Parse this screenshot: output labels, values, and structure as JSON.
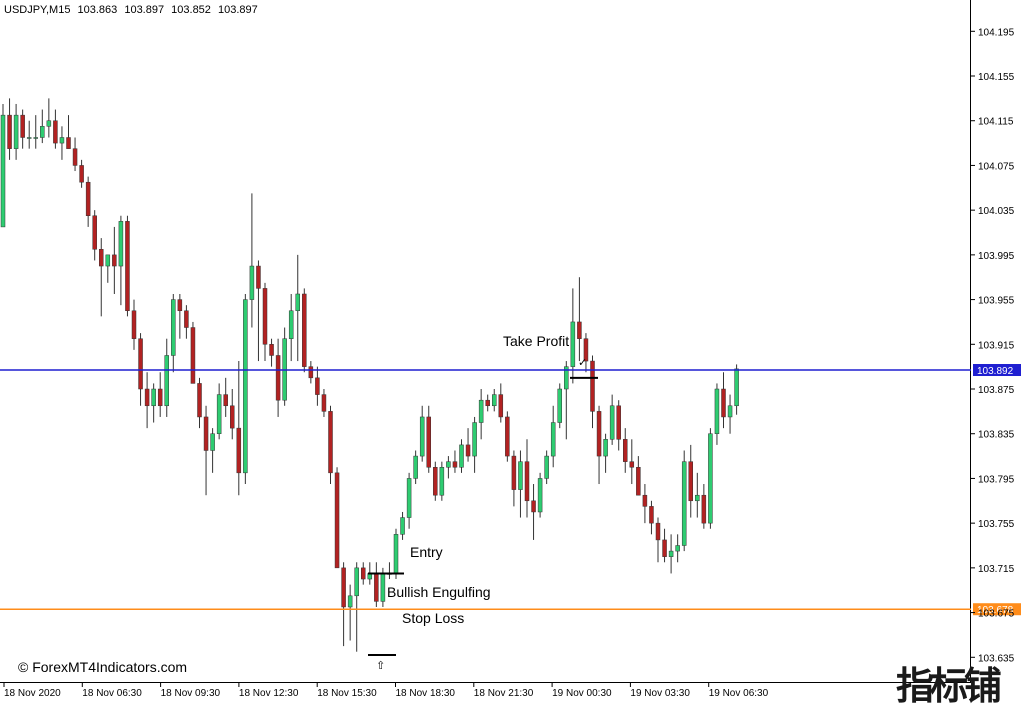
{
  "chart_header": {
    "symbol": "USDJPY,M15",
    "open": "103.863",
    "high": "103.897",
    "low": "103.852",
    "close": "103.897"
  },
  "annotations": {
    "take_profit": "Take Profit",
    "entry": "Entry",
    "pattern": "Bullish Engulfing",
    "stop_loss": "Stop Loss"
  },
  "copyright": "© ForexMT4Indicators.com",
  "watermark": "指标铺",
  "colors": {
    "bull": "#2ecc71",
    "bear": "#b22222",
    "take_profit_line": "#1f1fd1",
    "stop_line": "#ff8c1a",
    "background": "#ffffff"
  },
  "chart_data": {
    "type": "candlestick",
    "y_ticks": [
      "104.195",
      "104.155",
      "104.115",
      "104.075",
      "104.035",
      "103.995",
      "103.955",
      "103.915",
      "103.875",
      "103.835",
      "103.795",
      "103.755",
      "103.715",
      "103.675",
      "103.635"
    ],
    "ylim": [
      103.612,
      104.223
    ],
    "x_ticks": [
      "18 Nov 2020",
      "18 Nov 06:30",
      "18 Nov 09:30",
      "18 Nov 12:30",
      "18 Nov 15:30",
      "18 Nov 18:30",
      "18 Nov 21:30",
      "19 Nov 00:30",
      "19 Nov 03:30",
      "19 Nov 06:30"
    ],
    "price_lines": [
      {
        "label": "103.892",
        "value": 103.892,
        "color": "#1f1fd1"
      },
      {
        "label": "103.678",
        "value": 103.678,
        "color": "#ff8c1a"
      }
    ],
    "candles": [
      {
        "o": 104.02,
        "h": 104.13,
        "l": 104.06,
        "c": 104.12
      },
      {
        "o": 104.12,
        "h": 104.135,
        "l": 104.08,
        "c": 104.09
      },
      {
        "o": 104.09,
        "h": 104.13,
        "l": 104.08,
        "c": 104.12
      },
      {
        "o": 104.12,
        "h": 104.125,
        "l": 104.09,
        "c": 104.1
      },
      {
        "o": 104.1,
        "h": 104.115,
        "l": 104.09,
        "c": 104.1
      },
      {
        "o": 104.1,
        "h": 104.12,
        "l": 104.09,
        "c": 104.1
      },
      {
        "o": 104.1,
        "h": 104.125,
        "l": 104.095,
        "c": 104.11
      },
      {
        "o": 104.11,
        "h": 104.135,
        "l": 104.1,
        "c": 104.115
      },
      {
        "o": 104.115,
        "h": 104.125,
        "l": 104.09,
        "c": 104.095
      },
      {
        "o": 104.095,
        "h": 104.11,
        "l": 104.08,
        "c": 104.1
      },
      {
        "o": 104.1,
        "h": 104.12,
        "l": 104.09,
        "c": 104.09
      },
      {
        "o": 104.09,
        "h": 104.1,
        "l": 104.07,
        "c": 104.075
      },
      {
        "o": 104.075,
        "h": 104.08,
        "l": 104.055,
        "c": 104.06
      },
      {
        "o": 104.06,
        "h": 104.065,
        "l": 104.02,
        "c": 104.03
      },
      {
        "o": 104.03,
        "h": 104.035,
        "l": 103.99,
        "c": 104.0
      },
      {
        "o": 104.0,
        "h": 104.01,
        "l": 103.94,
        "c": 103.985
      },
      {
        "o": 103.985,
        "h": 103.995,
        "l": 103.97,
        "c": 103.995
      },
      {
        "o": 103.995,
        "h": 104.02,
        "l": 103.96,
        "c": 103.985
      },
      {
        "o": 103.985,
        "h": 104.03,
        "l": 103.95,
        "c": 104.025
      },
      {
        "o": 104.025,
        "h": 104.03,
        "l": 103.94,
        "c": 103.945
      },
      {
        "o": 103.945,
        "h": 103.955,
        "l": 103.91,
        "c": 103.92
      },
      {
        "o": 103.92,
        "h": 103.925,
        "l": 103.86,
        "c": 103.875
      },
      {
        "o": 103.875,
        "h": 103.89,
        "l": 103.84,
        "c": 103.86
      },
      {
        "o": 103.86,
        "h": 103.88,
        "l": 103.845,
        "c": 103.875
      },
      {
        "o": 103.875,
        "h": 103.89,
        "l": 103.85,
        "c": 103.86
      },
      {
        "o": 103.86,
        "h": 103.92,
        "l": 103.85,
        "c": 103.905
      },
      {
        "o": 103.905,
        "h": 103.96,
        "l": 103.89,
        "c": 103.955
      },
      {
        "o": 103.955,
        "h": 103.96,
        "l": 103.92,
        "c": 103.945
      },
      {
        "o": 103.945,
        "h": 103.95,
        "l": 103.92,
        "c": 103.93
      },
      {
        "o": 103.93,
        "h": 103.935,
        "l": 103.88,
        "c": 103.88
      },
      {
        "o": 103.88,
        "h": 103.885,
        "l": 103.84,
        "c": 103.85
      },
      {
        "o": 103.85,
        "h": 103.86,
        "l": 103.78,
        "c": 103.82
      },
      {
        "o": 103.82,
        "h": 103.84,
        "l": 103.8,
        "c": 103.835
      },
      {
        "o": 103.835,
        "h": 103.88,
        "l": 103.83,
        "c": 103.87
      },
      {
        "o": 103.87,
        "h": 103.885,
        "l": 103.85,
        "c": 103.86
      },
      {
        "o": 103.86,
        "h": 103.875,
        "l": 103.83,
        "c": 103.84
      },
      {
        "o": 103.84,
        "h": 103.9,
        "l": 103.78,
        "c": 103.8
      },
      {
        "o": 103.8,
        "h": 103.96,
        "l": 103.79,
        "c": 103.955
      },
      {
        "o": 103.955,
        "h": 104.05,
        "l": 103.93,
        "c": 103.985
      },
      {
        "o": 103.985,
        "h": 103.99,
        "l": 103.9,
        "c": 103.965
      },
      {
        "o": 103.965,
        "h": 103.97,
        "l": 103.9,
        "c": 103.915
      },
      {
        "o": 103.915,
        "h": 103.92,
        "l": 103.895,
        "c": 103.905
      },
      {
        "o": 103.905,
        "h": 103.92,
        "l": 103.85,
        "c": 103.865
      },
      {
        "o": 103.865,
        "h": 103.93,
        "l": 103.86,
        "c": 103.92
      },
      {
        "o": 103.92,
        "h": 103.96,
        "l": 103.9,
        "c": 103.945
      },
      {
        "o": 103.945,
        "h": 103.995,
        "l": 103.9,
        "c": 103.96
      },
      {
        "o": 103.96,
        "h": 103.965,
        "l": 103.89,
        "c": 103.895
      },
      {
        "o": 103.895,
        "h": 103.9,
        "l": 103.88,
        "c": 103.885
      },
      {
        "o": 103.885,
        "h": 103.895,
        "l": 103.86,
        "c": 103.87
      },
      {
        "o": 103.87,
        "h": 103.875,
        "l": 103.85,
        "c": 103.855
      },
      {
        "o": 103.855,
        "h": 103.86,
        "l": 103.79,
        "c": 103.8
      },
      {
        "o": 103.8,
        "h": 103.805,
        "l": 103.715,
        "c": 103.715
      },
      {
        "o": 103.715,
        "h": 103.72,
        "l": 103.645,
        "c": 103.68
      },
      {
        "o": 103.68,
        "h": 103.7,
        "l": 103.65,
        "c": 103.69
      },
      {
        "o": 103.69,
        "h": 103.72,
        "l": 103.64,
        "c": 103.715
      },
      {
        "o": 103.715,
        "h": 103.72,
        "l": 103.7,
        "c": 103.705
      },
      {
        "o": 103.705,
        "h": 103.72,
        "l": 103.7,
        "c": 103.71
      },
      {
        "o": 103.71,
        "h": 103.72,
        "l": 103.68,
        "c": 103.685
      },
      {
        "o": 103.685,
        "h": 103.715,
        "l": 103.68,
        "c": 103.71
      },
      {
        "o": 103.71,
        "h": 103.72,
        "l": 103.705,
        "c": 103.71
      },
      {
        "o": 103.71,
        "h": 103.75,
        "l": 103.705,
        "c": 103.745
      },
      {
        "o": 103.745,
        "h": 103.765,
        "l": 103.74,
        "c": 103.76
      },
      {
        "o": 103.76,
        "h": 103.8,
        "l": 103.75,
        "c": 103.795
      },
      {
        "o": 103.795,
        "h": 103.82,
        "l": 103.79,
        "c": 103.815
      },
      {
        "o": 103.815,
        "h": 103.86,
        "l": 103.81,
        "c": 103.85
      },
      {
        "o": 103.85,
        "h": 103.86,
        "l": 103.8,
        "c": 103.805
      },
      {
        "o": 103.805,
        "h": 103.81,
        "l": 103.775,
        "c": 103.78
      },
      {
        "o": 103.78,
        "h": 103.81,
        "l": 103.775,
        "c": 103.805
      },
      {
        "o": 103.805,
        "h": 103.815,
        "l": 103.795,
        "c": 103.81
      },
      {
        "o": 103.81,
        "h": 103.82,
        "l": 103.8,
        "c": 103.805
      },
      {
        "o": 103.805,
        "h": 103.83,
        "l": 103.8,
        "c": 103.825
      },
      {
        "o": 103.825,
        "h": 103.84,
        "l": 103.81,
        "c": 103.815
      },
      {
        "o": 103.815,
        "h": 103.85,
        "l": 103.8,
        "c": 103.845
      },
      {
        "o": 103.845,
        "h": 103.875,
        "l": 103.83,
        "c": 103.865
      },
      {
        "o": 103.865,
        "h": 103.87,
        "l": 103.855,
        "c": 103.86
      },
      {
        "o": 103.86,
        "h": 103.875,
        "l": 103.855,
        "c": 103.87
      },
      {
        "o": 103.87,
        "h": 103.88,
        "l": 103.845,
        "c": 103.85
      },
      {
        "o": 103.85,
        "h": 103.855,
        "l": 103.81,
        "c": 103.815
      },
      {
        "o": 103.815,
        "h": 103.82,
        "l": 103.77,
        "c": 103.785
      },
      {
        "o": 103.785,
        "h": 103.82,
        "l": 103.76,
        "c": 103.81
      },
      {
        "o": 103.81,
        "h": 103.83,
        "l": 103.76,
        "c": 103.775
      },
      {
        "o": 103.775,
        "h": 103.79,
        "l": 103.74,
        "c": 103.765
      },
      {
        "o": 103.765,
        "h": 103.8,
        "l": 103.76,
        "c": 103.795
      },
      {
        "o": 103.795,
        "h": 103.82,
        "l": 103.79,
        "c": 103.815
      },
      {
        "o": 103.815,
        "h": 103.86,
        "l": 103.805,
        "c": 103.845
      },
      {
        "o": 103.845,
        "h": 103.88,
        "l": 103.84,
        "c": 103.875
      },
      {
        "o": 103.875,
        "h": 103.9,
        "l": 103.83,
        "c": 103.895
      },
      {
        "o": 103.895,
        "h": 103.965,
        "l": 103.88,
        "c": 103.935
      },
      {
        "o": 103.935,
        "h": 103.975,
        "l": 103.9,
        "c": 103.92
      },
      {
        "o": 103.92,
        "h": 103.925,
        "l": 103.89,
        "c": 103.9
      },
      {
        "o": 103.9,
        "h": 103.905,
        "l": 103.84,
        "c": 103.855
      },
      {
        "o": 103.855,
        "h": 103.86,
        "l": 103.79,
        "c": 103.815
      },
      {
        "o": 103.815,
        "h": 103.835,
        "l": 103.8,
        "c": 103.83
      },
      {
        "o": 103.83,
        "h": 103.87,
        "l": 103.825,
        "c": 103.86
      },
      {
        "o": 103.86,
        "h": 103.865,
        "l": 103.82,
        "c": 103.83
      },
      {
        "o": 103.83,
        "h": 103.84,
        "l": 103.8,
        "c": 103.81
      },
      {
        "o": 103.81,
        "h": 103.83,
        "l": 103.79,
        "c": 103.805
      },
      {
        "o": 103.805,
        "h": 103.815,
        "l": 103.78,
        "c": 103.78
      },
      {
        "o": 103.78,
        "h": 103.79,
        "l": 103.755,
        "c": 103.77
      },
      {
        "o": 103.77,
        "h": 103.775,
        "l": 103.745,
        "c": 103.755
      },
      {
        "o": 103.755,
        "h": 103.76,
        "l": 103.72,
        "c": 103.74
      },
      {
        "o": 103.74,
        "h": 103.75,
        "l": 103.72,
        "c": 103.725
      },
      {
        "o": 103.725,
        "h": 103.745,
        "l": 103.71,
        "c": 103.73
      },
      {
        "o": 103.73,
        "h": 103.745,
        "l": 103.72,
        "c": 103.735
      },
      {
        "o": 103.735,
        "h": 103.82,
        "l": 103.73,
        "c": 103.81
      },
      {
        "o": 103.81,
        "h": 103.825,
        "l": 103.76,
        "c": 103.775
      },
      {
        "o": 103.775,
        "h": 103.8,
        "l": 103.76,
        "c": 103.78
      },
      {
        "o": 103.78,
        "h": 103.79,
        "l": 103.75,
        "c": 103.755
      },
      {
        "o": 103.755,
        "h": 103.84,
        "l": 103.75,
        "c": 103.835
      },
      {
        "o": 103.835,
        "h": 103.88,
        "l": 103.825,
        "c": 103.875
      },
      {
        "o": 103.875,
        "h": 103.89,
        "l": 103.84,
        "c": 103.85
      },
      {
        "o": 103.85,
        "h": 103.87,
        "l": 103.835,
        "c": 103.86
      },
      {
        "o": 103.86,
        "h": 103.897,
        "l": 103.852,
        "c": 103.893
      }
    ]
  }
}
